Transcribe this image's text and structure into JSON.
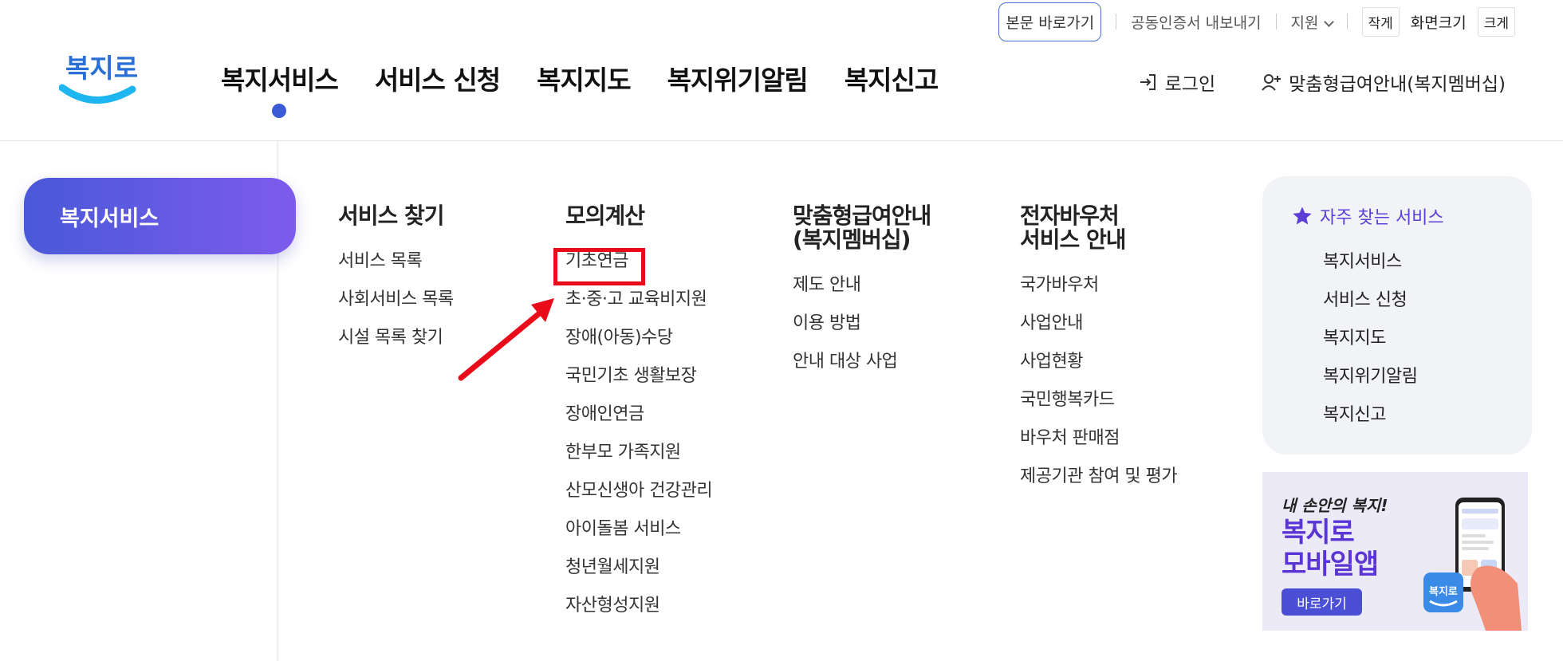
{
  "utility": {
    "skip_to_content": "본문 바로가기",
    "export_cert": "공동인증서 내보내기",
    "region": "지원",
    "size_small": "작게",
    "size_label": "화면크기",
    "size_large": "크게"
  },
  "logo": {
    "text": "복지로"
  },
  "gnb": [
    {
      "label": "복지서비스",
      "active": true
    },
    {
      "label": "서비스 신청"
    },
    {
      "label": "복지지도"
    },
    {
      "label": "복지위기알림"
    },
    {
      "label": "복지신고"
    }
  ],
  "header_right": {
    "login": "로그인",
    "membership": "맞춤형급여안내(복지멤버십)"
  },
  "side": {
    "title": "복지서비스"
  },
  "columns": [
    {
      "title": "서비스 찾기",
      "items": [
        "서비스 목록",
        "사회서비스 목록",
        "시설 목록 찾기"
      ]
    },
    {
      "title": "모의계산",
      "items": [
        "기초연금",
        "초·중·고 교육비지원",
        "장애(아동)수당",
        "국민기초 생활보장",
        "장애인연금",
        "한부모 가족지원",
        "산모신생아 건강관리",
        "아이돌봄 서비스",
        "청년월세지원",
        "자산형성지원"
      ]
    },
    {
      "title_line1": "맞춤형급여안내",
      "title_line2": "(복지멤버십)",
      "items": [
        "제도 안내",
        "이용 방법",
        "안내 대상 사업"
      ]
    },
    {
      "title_line1": "전자바우처",
      "title_line2": "서비스 안내",
      "items": [
        "국가바우처",
        "사업안내",
        "사업현황",
        "국민행복카드",
        "바우처 판매점",
        "제공기관 참여 및 평가"
      ]
    }
  ],
  "favorites": {
    "title": "자주 찾는 서비스",
    "items": [
      "복지서비스",
      "서비스 신청",
      "복지지도",
      "복지위기알림",
      "복지신고"
    ]
  },
  "banner": {
    "line1": "내 손안의 복지!",
    "line2": "복지로",
    "line3": "모바일앱",
    "button": "바로가기",
    "app_logo": "복지로"
  },
  "colors": {
    "accent": "#3b5bd6",
    "pill_start": "#4a59d8",
    "pill_end": "#7d5bec",
    "highlight": "#ea0b1a",
    "favorite_title": "#5b3fd6"
  },
  "icons": {
    "login": "login-icon",
    "membership": "user-plus-icon",
    "favorites": "star-icon",
    "region": "chevron-down-icon"
  },
  "annotation": {
    "highlighted_item": "기초연금"
  }
}
